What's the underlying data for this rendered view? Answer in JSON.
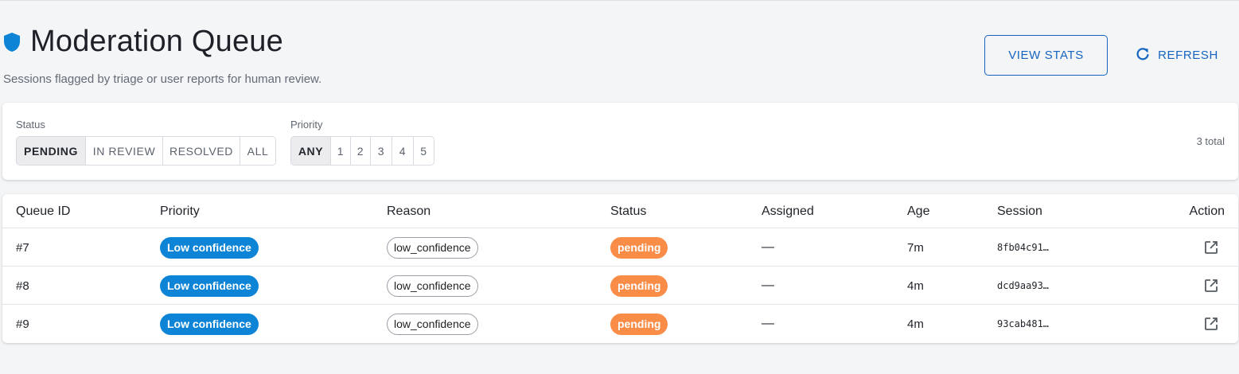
{
  "header": {
    "title": "Moderation Queue",
    "subtitle": "Sessions flagged by triage or user reports for human review.",
    "view_stats_label": "VIEW STATS",
    "refresh_label": "REFRESH",
    "icons": {
      "title": "shield-icon",
      "refresh": "refresh-icon"
    },
    "accent_color": "#1565c0"
  },
  "filters": {
    "status_label": "Status",
    "status_options": [
      "PENDING",
      "IN REVIEW",
      "RESOLVED",
      "ALL"
    ],
    "status_selected": "PENDING",
    "priority_label": "Priority",
    "priority_options": [
      "ANY",
      "1",
      "2",
      "3",
      "4",
      "5"
    ],
    "priority_selected": "ANY",
    "total": "3 total"
  },
  "table": {
    "columns": [
      "Queue ID",
      "Priority",
      "Reason",
      "Status",
      "Assigned",
      "Age",
      "Session",
      "Action"
    ],
    "rows": [
      {
        "id": "#7",
        "priority": "Low confidence",
        "reason": "low_confidence",
        "status": "pending",
        "assigned": "—",
        "age": "7m",
        "session": "8fb04c91…"
      },
      {
        "id": "#8",
        "priority": "Low confidence",
        "reason": "low_confidence",
        "status": "pending",
        "assigned": "—",
        "age": "4m",
        "session": "dcd9aa93…"
      },
      {
        "id": "#9",
        "priority": "Low confidence",
        "reason": "low_confidence",
        "status": "pending",
        "assigned": "—",
        "age": "4m",
        "session": "93cab481…"
      }
    ],
    "action_icon": "open-in-new-icon",
    "colors": {
      "priority_chip": "#0d84d6",
      "status_pending": "#f98d48"
    }
  }
}
